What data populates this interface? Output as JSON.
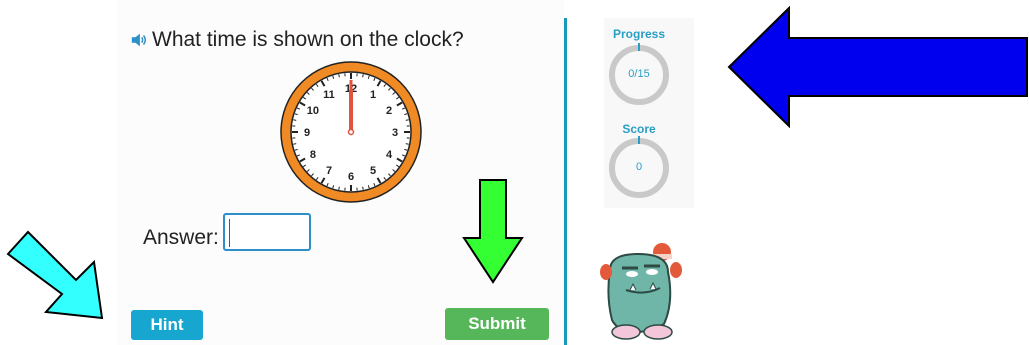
{
  "question": {
    "text": "What time is shown on the clock?",
    "speaker_icon": "speaker-icon"
  },
  "clock": {
    "numbers": [
      "12",
      "1",
      "2",
      "3",
      "4",
      "5",
      "6",
      "7",
      "8",
      "9",
      "10",
      "11"
    ],
    "hour_hand_time": "12:00",
    "face_color": "#ffffff",
    "rim_color": "#f08a24",
    "hand_color": "#e0533f"
  },
  "answer": {
    "label": "Answer:",
    "value": ""
  },
  "buttons": {
    "hint_label": "Hint",
    "submit_label": "Submit"
  },
  "stats": {
    "progress_label": "Progress",
    "progress_value": "0/15",
    "score_label": "Score",
    "score_value": "0"
  },
  "colors": {
    "accent": "#1a9ab8",
    "hint": "#16a6d0",
    "submit": "#55b75a",
    "arrow_blue": "#0000ee",
    "arrow_green": "#33ff33",
    "arrow_cyan": "#33ffff"
  }
}
